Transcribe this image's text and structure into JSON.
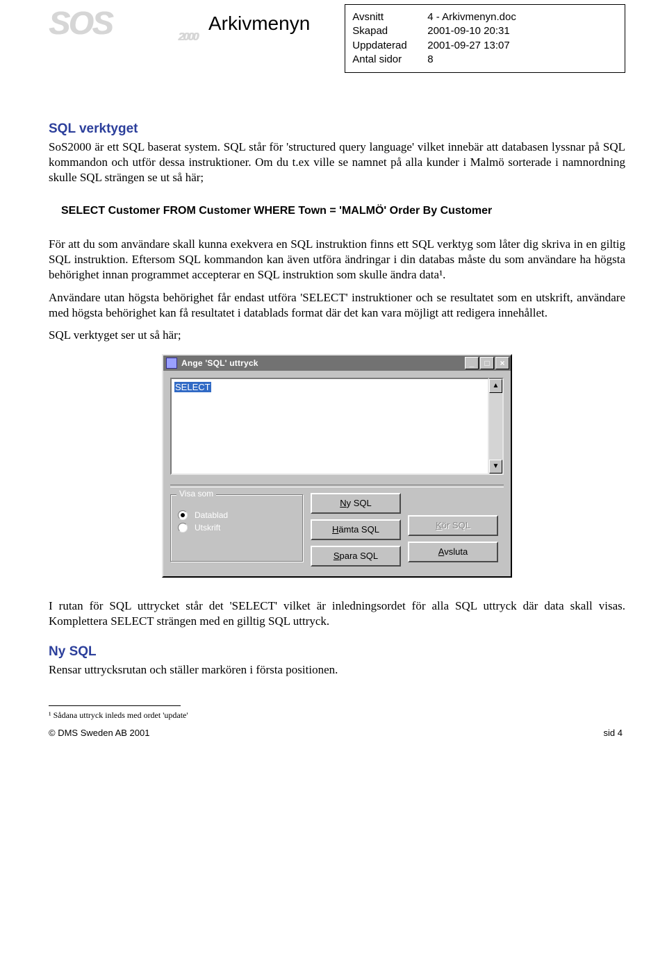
{
  "header": {
    "logo_text": "SOS",
    "logo_sub": "2000",
    "title": "Arkivmenyn",
    "meta": {
      "section_label": "Avsnitt",
      "section_value": "4 - Arkivmenyn.doc",
      "created_label": "Skapad",
      "created_value": "2001-09-10 20:31",
      "updated_label": "Uppdaterad",
      "updated_value": "2001-09-27 13:07",
      "pages_label": "Antal sidor",
      "pages_value": "8"
    }
  },
  "section1": {
    "heading": "SQL verktyget",
    "p1": "SoS2000 är ett SQL baserat system. SQL står för 'structured query language' vilket innebär att databasen lyssnar på SQL kommandon och utför dessa instruktioner. Om du t.ex ville se namnet på alla kunder i Malmö sorterade i namnordning skulle SQL strängen se ut så här;",
    "code": "SELECT Customer FROM Customer WHERE Town = 'MALMÖ' Order By Customer",
    "p2": "För att du som användare skall kunna exekvera en SQL instruktion finns ett SQL verktyg som låter dig skriva in en giltig SQL instruktion. Eftersom SQL kommandon kan även utföra ändringar i din databas måste du som användare ha högsta behörighet innan programmet accepterar en SQL instruktion som skulle ändra data¹.",
    "p3": "Användare utan högsta behörighet får endast utföra 'SELECT' instruktioner och se resultatet som en utskrift, användare med högsta behörighet kan få resultatet i datablads format där det kan vara möjligt att redigera innehållet.",
    "p4": "SQL verktyget ser ut så här;"
  },
  "dialog": {
    "title": "Ange 'SQL' uttryck",
    "text_selected": "SELECT",
    "group_legend": "Visa som",
    "radio1": "Datablad",
    "radio2": "Utskrift",
    "btn_ny_pre": "N",
    "btn_ny_rest": "y SQL",
    "btn_hamta_pre": "H",
    "btn_hamta_rest": "ämta SQL",
    "btn_spara_pre": "S",
    "btn_spara_rest": "para SQL",
    "btn_kor_pre": "K",
    "btn_kor_rest": "ör SQL",
    "btn_av_pre": "A",
    "btn_av_rest": "vsluta",
    "tb_min": "_",
    "tb_max": "□",
    "tb_close": "×",
    "arrow_up": "▲",
    "arrow_down": "▼"
  },
  "section2": {
    "p5": "I rutan för SQL uttrycket står det 'SELECT' vilket är inledningsordet för alla SQL uttryck där data skall visas. Komplettera SELECT strängen med en gilltig SQL uttryck.",
    "heading2": "Ny SQL",
    "p6": "Rensar uttrycksrutan och ställer markören i första positionen."
  },
  "footnote": "¹ Sådana uttryck inleds med ordet 'update'",
  "footer": {
    "left": "© DMS Sweden AB 2001",
    "right": "sid 4"
  }
}
